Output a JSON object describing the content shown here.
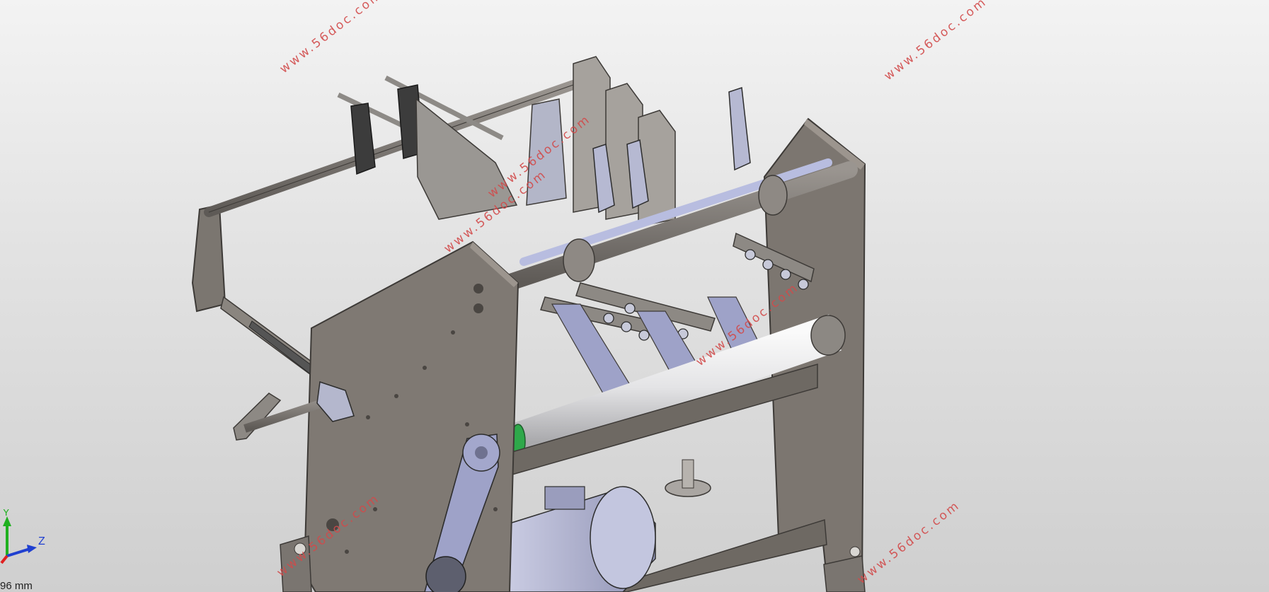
{
  "viewport": {
    "background_top": "#f3f3f3",
    "background_bottom": "#cfcfcf",
    "model_colors": {
      "plate": "#7f7a74",
      "plate_edge": "#4e4a46",
      "shaft": "#6e6a66",
      "roller": "#e8e8ea",
      "accent_blue": "#aab0d8",
      "dark_part": "#3a3a3a"
    }
  },
  "watermarks": [
    {
      "text": "www.56doc.com"
    },
    {
      "text": "www.56doc.com"
    },
    {
      "text": "www.56doc.com"
    },
    {
      "text": "www.56doc.com"
    },
    {
      "text": "www.56doc.com"
    },
    {
      "text": "www.56doc.com"
    },
    {
      "text": "www.56doc.com"
    }
  ],
  "triad": {
    "y_label": "Y",
    "z_label": "Z",
    "x_color": "#e02020",
    "y_color": "#20b020",
    "z_color": "#2040d0"
  },
  "scale_label": "96 mm"
}
